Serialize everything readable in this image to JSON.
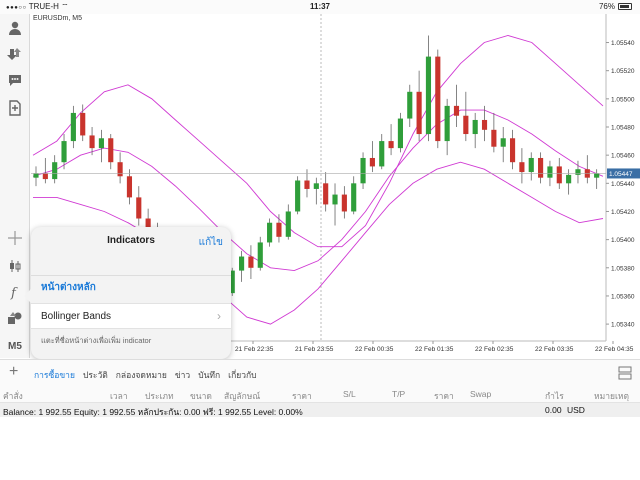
{
  "status_bar": {
    "carrier": "TRUE-H",
    "time": "11:37",
    "battery": "76%"
  },
  "left_toolbar": {
    "items": [
      {
        "icon": "account-icon"
      },
      {
        "icon": "download-icon"
      },
      {
        "icon": "chat-icon"
      },
      {
        "icon": "new-document-icon"
      },
      {
        "icon": "crosshair-icon"
      },
      {
        "icon": "candlestick-icon"
      },
      {
        "icon": "function-icon"
      },
      {
        "icon": "objects-icon"
      }
    ],
    "timeframe_label": "M5"
  },
  "chart": {
    "symbol": "EURUSDm, M5",
    "current_price_label": "1.05447"
  },
  "chart_data": {
    "type": "candlestick",
    "symbol": "EURUSDm",
    "timeframe": "M5",
    "y_ticks": [
      "1.05540",
      "1.05520",
      "1.05500",
      "1.05480",
      "1.05460",
      "1.05440",
      "1.05420",
      "1.05400",
      "1.05380",
      "1.05360",
      "1.05340"
    ],
    "ylim": [
      1.05328,
      1.05556
    ],
    "current_price": 1.05447,
    "x_ticks": [
      "21 Feb 22:35",
      "21 Feb 23:55",
      "22 Feb 00:35",
      "22 Feb 01:35",
      "22 Feb 02:35",
      "22 Feb 03:35",
      "22 Feb 04:35"
    ],
    "indicator": "Bollinger Bands",
    "bands": {
      "upper": [
        1.0546,
        1.0547,
        1.0549,
        1.05505,
        1.0551,
        1.055,
        1.05485,
        1.0547,
        1.05455,
        1.0544,
        1.0542,
        1.05405,
        1.05395,
        1.05395,
        1.0541,
        1.0544,
        1.05475,
        1.05505,
        1.05525,
        1.0554,
        1.05545,
        1.0554,
        1.05525,
        1.0551,
        1.05495
      ],
      "middle": [
        1.05445,
        1.0545,
        1.0546,
        1.05465,
        1.05462,
        1.05452,
        1.05438,
        1.05422,
        1.05405,
        1.0539,
        1.0538,
        1.05378,
        1.05385,
        1.054,
        1.0542,
        1.05445,
        1.05465,
        1.05482,
        1.05492,
        1.05492,
        1.05485,
        1.05475,
        1.05463,
        1.05452,
        1.05445
      ],
      "lower": [
        1.0543,
        1.0543,
        1.05425,
        1.0542,
        1.05412,
        1.05402,
        1.0539,
        1.05375,
        1.0536,
        1.05345,
        1.0534,
        1.0535,
        1.05365,
        1.05385,
        1.05405,
        1.05425,
        1.0544,
        1.0545,
        1.05455,
        1.0545,
        1.0544,
        1.0543,
        1.0542,
        1.05412,
        1.05415
      ]
    },
    "candles": [
      {
        "o": 1.05444,
        "h": 1.05452,
        "l": 1.05438,
        "c": 1.05447
      },
      {
        "o": 1.05447,
        "h": 1.05458,
        "l": 1.0544,
        "c": 1.05443
      },
      {
        "o": 1.05443,
        "h": 1.0546,
        "l": 1.0544,
        "c": 1.05455
      },
      {
        "o": 1.05455,
        "h": 1.05475,
        "l": 1.0545,
        "c": 1.0547
      },
      {
        "o": 1.0547,
        "h": 1.05495,
        "l": 1.05465,
        "c": 1.0549
      },
      {
        "o": 1.0549,
        "h": 1.05496,
        "l": 1.0547,
        "c": 1.05474
      },
      {
        "o": 1.05474,
        "h": 1.0548,
        "l": 1.0546,
        "c": 1.05465
      },
      {
        "o": 1.05465,
        "h": 1.05478,
        "l": 1.05455,
        "c": 1.05472
      },
      {
        "o": 1.05472,
        "h": 1.05475,
        "l": 1.0545,
        "c": 1.05455
      },
      {
        "o": 1.05455,
        "h": 1.05462,
        "l": 1.0544,
        "c": 1.05445
      },
      {
        "o": 1.05445,
        "h": 1.0545,
        "l": 1.05425,
        "c": 1.0543
      },
      {
        "o": 1.0543,
        "h": 1.05438,
        "l": 1.0541,
        "c": 1.05415
      },
      {
        "o": 1.05415,
        "h": 1.05422,
        "l": 1.054,
        "c": 1.05405
      },
      {
        "o": 1.05405,
        "h": 1.05412,
        "l": 1.05392,
        "c": 1.05398
      },
      {
        "o": 1.05398,
        "h": 1.05405,
        "l": 1.05388,
        "c": 1.05392
      },
      {
        "o": 1.05392,
        "h": 1.054,
        "l": 1.0538,
        "c": 1.05384
      },
      {
        "o": 1.05384,
        "h": 1.0539,
        "l": 1.0537,
        "c": 1.05375
      },
      {
        "o": 1.05375,
        "h": 1.05382,
        "l": 1.05355,
        "c": 1.0536
      },
      {
        "o": 1.0536,
        "h": 1.0537,
        "l": 1.05348,
        "c": 1.05352
      },
      {
        "o": 1.05352,
        "h": 1.0536,
        "l": 1.0534,
        "c": 1.05345
      },
      {
        "o": 1.05345,
        "h": 1.05365,
        "l": 1.05343,
        "c": 1.05362
      },
      {
        "o": 1.05362,
        "h": 1.0538,
        "l": 1.0536,
        "c": 1.05378
      },
      {
        "o": 1.05378,
        "h": 1.05392,
        "l": 1.0537,
        "c": 1.05388
      },
      {
        "o": 1.05388,
        "h": 1.05396,
        "l": 1.05372,
        "c": 1.0538
      },
      {
        "o": 1.0538,
        "h": 1.05402,
        "l": 1.05378,
        "c": 1.05398
      },
      {
        "o": 1.05398,
        "h": 1.05415,
        "l": 1.05395,
        "c": 1.05412
      },
      {
        "o": 1.05412,
        "h": 1.05418,
        "l": 1.05398,
        "c": 1.05402
      },
      {
        "o": 1.05402,
        "h": 1.05425,
        "l": 1.054,
        "c": 1.0542
      },
      {
        "o": 1.0542,
        "h": 1.05445,
        "l": 1.05418,
        "c": 1.05442
      },
      {
        "o": 1.05442,
        "h": 1.0545,
        "l": 1.0543,
        "c": 1.05436
      },
      {
        "o": 1.05436,
        "h": 1.05444,
        "l": 1.05425,
        "c": 1.0544
      },
      {
        "o": 1.0544,
        "h": 1.05448,
        "l": 1.0542,
        "c": 1.05425
      },
      {
        "o": 1.05425,
        "h": 1.0544,
        "l": 1.0541,
        "c": 1.05432
      },
      {
        "o": 1.05432,
        "h": 1.05438,
        "l": 1.05415,
        "c": 1.0542
      },
      {
        "o": 1.0542,
        "h": 1.05445,
        "l": 1.05418,
        "c": 1.0544
      },
      {
        "o": 1.0544,
        "h": 1.05462,
        "l": 1.05436,
        "c": 1.05458
      },
      {
        "o": 1.05458,
        "h": 1.0547,
        "l": 1.05448,
        "c": 1.05452
      },
      {
        "o": 1.05452,
        "h": 1.05475,
        "l": 1.0545,
        "c": 1.0547
      },
      {
        "o": 1.0547,
        "h": 1.05482,
        "l": 1.0546,
        "c": 1.05465
      },
      {
        "o": 1.05465,
        "h": 1.0549,
        "l": 1.05462,
        "c": 1.05486
      },
      {
        "o": 1.05486,
        "h": 1.0551,
        "l": 1.0548,
        "c": 1.05505
      },
      {
        "o": 1.05505,
        "h": 1.0552,
        "l": 1.0547,
        "c": 1.05475
      },
      {
        "o": 1.05475,
        "h": 1.05545,
        "l": 1.0547,
        "c": 1.0553
      },
      {
        "o": 1.0553,
        "h": 1.05535,
        "l": 1.05465,
        "c": 1.0547
      },
      {
        "o": 1.0547,
        "h": 1.055,
        "l": 1.0546,
        "c": 1.05495
      },
      {
        "o": 1.05495,
        "h": 1.0551,
        "l": 1.0548,
        "c": 1.05488
      },
      {
        "o": 1.05488,
        "h": 1.05505,
        "l": 1.0547,
        "c": 1.05475
      },
      {
        "o": 1.05475,
        "h": 1.0549,
        "l": 1.05465,
        "c": 1.05485
      },
      {
        "o": 1.05485,
        "h": 1.05495,
        "l": 1.0547,
        "c": 1.05478
      },
      {
        "o": 1.05478,
        "h": 1.0549,
        "l": 1.05462,
        "c": 1.05466
      },
      {
        "o": 1.05466,
        "h": 1.0548,
        "l": 1.05455,
        "c": 1.05472
      },
      {
        "o": 1.05472,
        "h": 1.05478,
        "l": 1.0545,
        "c": 1.05455
      },
      {
        "o": 1.05455,
        "h": 1.05465,
        "l": 1.0544,
        "c": 1.05448
      },
      {
        "o": 1.05448,
        "h": 1.05462,
        "l": 1.05442,
        "c": 1.05458
      },
      {
        "o": 1.05458,
        "h": 1.05462,
        "l": 1.0544,
        "c": 1.05444
      },
      {
        "o": 1.05444,
        "h": 1.05456,
        "l": 1.05438,
        "c": 1.05452
      },
      {
        "o": 1.05452,
        "h": 1.05458,
        "l": 1.05436,
        "c": 1.0544
      },
      {
        "o": 1.0544,
        "h": 1.0545,
        "l": 1.05432,
        "c": 1.05446
      },
      {
        "o": 1.05446,
        "h": 1.05456,
        "l": 1.0544,
        "c": 1.0545
      },
      {
        "o": 1.0545,
        "h": 1.0546,
        "l": 1.0544,
        "c": 1.05444
      },
      {
        "o": 1.05444,
        "h": 1.0545,
        "l": 1.05436,
        "c": 1.05447
      }
    ]
  },
  "indicators_popover": {
    "title": "Indicators",
    "edit_label": "แก้ไข",
    "section_title": "หน้าต่างหลัก",
    "items": [
      {
        "label": "Bollinger Bands"
      }
    ],
    "hint": "แตะที่ชื่อหน้าต่างเพื่อเพิ่ม indicator"
  },
  "tabs": {
    "items": [
      {
        "label": "การซื้อขาย",
        "active": true
      },
      {
        "label": "ประวัติ",
        "active": false
      },
      {
        "label": "กล่องจดหมาย",
        "active": false
      },
      {
        "label": "ข่าว",
        "active": false
      },
      {
        "label": "บันทึก",
        "active": false
      },
      {
        "label": "เกี่ยวกับ",
        "active": false
      }
    ]
  },
  "trade_columns": [
    "คำสั่ง",
    "เวลา",
    "ประเภท",
    "ขนาด",
    "สัญลักษณ์",
    "ราคา",
    "S/L",
    "T/P",
    "ราคา",
    "Swap",
    "กำไร",
    "หมายเหตุ"
  ],
  "balance_row": {
    "text": "Balance: 1 992.55 Equity: 1 992.55 หลักประกัน: 0.00 ฟรี: 1 992.55 Level: 0.00%",
    "profit": "0.00",
    "currency": "USD"
  },
  "colors": {
    "bull": "#2f9e3a",
    "bear": "#c9342d",
    "bands": "#d03ad3",
    "accent": "#1a7ad8"
  }
}
